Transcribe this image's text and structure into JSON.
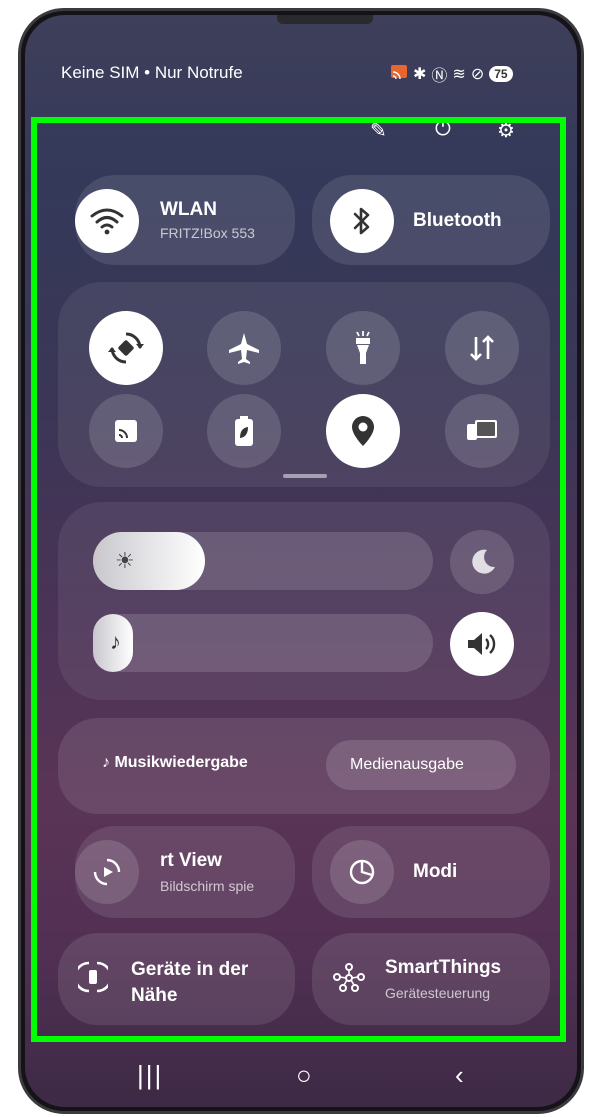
{
  "status_bar": {
    "carrier_text": "Keine SIM • Nur Notrufe",
    "battery_level": "75"
  },
  "top_actions": {
    "edit_icon": "pencil-icon",
    "power_icon": "power-icon",
    "settings_icon": "gear-icon"
  },
  "tiles": {
    "wlan": {
      "title": "WLAN",
      "subtitle": "FRITZ!Box 553",
      "state": "on"
    },
    "bluetooth": {
      "title": "Bluetooth",
      "state": "on"
    },
    "smart_view": {
      "title": "rt View",
      "subtitle": "Bildschirm spie",
      "state": "off"
    },
    "modi": {
      "title": "Modi",
      "state": "off"
    },
    "nearby": {
      "title": "Geräte in der Nähe",
      "state": "off"
    },
    "smartthings": {
      "title": "SmartThings",
      "subtitle": "Gerätesteuerung",
      "state": "off"
    }
  },
  "quick_toggles": [
    {
      "name": "auto-rotate",
      "state": "on"
    },
    {
      "name": "airplane-mode",
      "state": "off"
    },
    {
      "name": "flashlight",
      "state": "off"
    },
    {
      "name": "mobile-data",
      "state": "off"
    },
    {
      "name": "cast",
      "state": "off"
    },
    {
      "name": "power-saving",
      "state": "off"
    },
    {
      "name": "location",
      "state": "on"
    },
    {
      "name": "device-control",
      "state": "off"
    }
  ],
  "sliders": {
    "brightness_level": 0.33,
    "volume_level": 0.1
  },
  "media": {
    "music_label": "Musikwiedergabe",
    "output_label": "Medienausgabe"
  },
  "colors": {
    "active": "#ffffff",
    "accent_green": "#00ff00"
  }
}
